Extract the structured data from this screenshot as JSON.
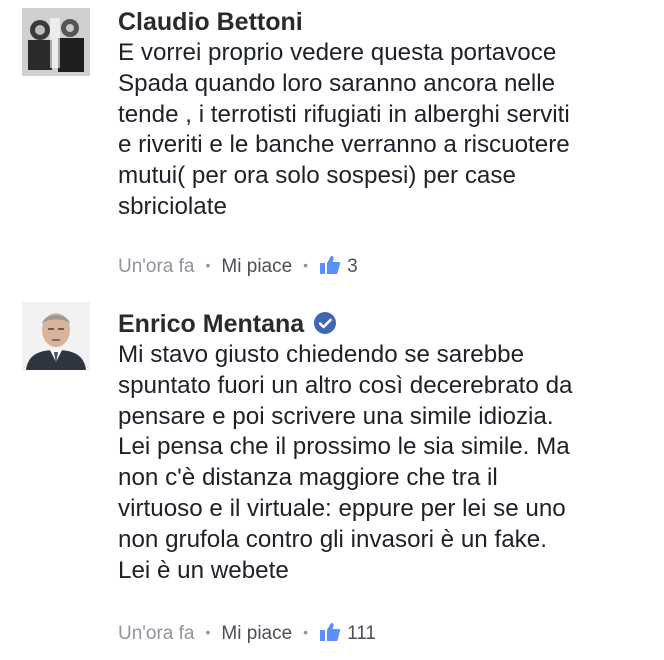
{
  "comments": [
    {
      "author": "Claudio Bettoni",
      "verified": false,
      "text": "E vorrei proprio vedere questa portavoce\nSpada quando loro saranno ancora nelle\ntende , i terrotisti rifugiati in alberghi serviti\ne riveriti e le banche verranno a riscuotere\nmutui( per ora solo sospesi) per case\nsbriciolate",
      "time": "Un'ora fa",
      "like_label": "Mi piace",
      "likes": "3"
    },
    {
      "author": "Enrico Mentana",
      "verified": true,
      "text": "Mi stavo giusto chiedendo se sarebbe\nspuntato fuori un altro così decerebrato da\npensare e poi scrivere una simile idiozia.\nLei pensa che il prossimo le sia simile. Ma\nnon c'è distanza maggiore che tra il\nvirtuoso e il virtuale: eppure per lei se uno\nnon grufola contro gli invasori è un fake.\nLei è un webete",
      "time": "Un'ora fa",
      "like_label": "Mi piace",
      "likes": "111"
    }
  ],
  "colors": {
    "link": "#4267b2",
    "meta": "#90949c",
    "text": "#1d2129"
  },
  "icons": {
    "verified": "verified-badge-icon",
    "reaction": "thumbs-up-icon"
  }
}
